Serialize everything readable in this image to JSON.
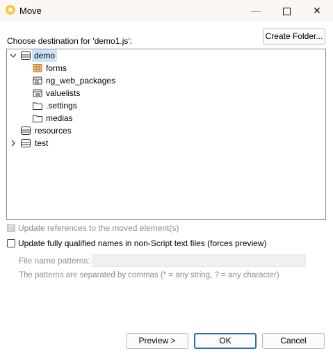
{
  "window": {
    "title": "Move",
    "minimize_glyph": "—",
    "close_glyph": "✕"
  },
  "dialog": {
    "choose_label": "Choose destination for 'demo1.js':",
    "create_folder_label": "Create Folder..."
  },
  "tree": {
    "root": {
      "label": "demo",
      "expanded": true,
      "icon": "project-icon"
    },
    "children": [
      {
        "label": "forms",
        "icon": "forms-folder-icon"
      },
      {
        "label": "ng_web_packages",
        "icon": "packages-folder-icon"
      },
      {
        "label": "valuelists",
        "icon": "valuelists-folder-icon"
      },
      {
        "label": ".settings",
        "icon": "folder-icon"
      },
      {
        "label": "medias",
        "icon": "folder-icon"
      }
    ],
    "siblings": [
      {
        "label": "resources",
        "icon": "project-icon"
      },
      {
        "label": "test",
        "icon": "project-icon",
        "collapsed": true
      }
    ]
  },
  "options": {
    "update_references_label": "Update references to the moved element(s)",
    "update_references_checked": true,
    "update_references_enabled": false,
    "update_qualified_label": "Update fully qualified names in non-Script text files (forces preview)",
    "update_qualified_checked": false,
    "file_patterns_label": "File name patterns:",
    "file_patterns_value": "",
    "patterns_hint": "The patterns are separated by commas (* = any string, ? = any character)"
  },
  "buttons": {
    "preview": "Preview >",
    "ok": "OK",
    "cancel": "Cancel"
  },
  "colors": {
    "accent": "#2b6cb0",
    "selection": "#cde3f7",
    "titlebar": "#fbf8f3"
  }
}
